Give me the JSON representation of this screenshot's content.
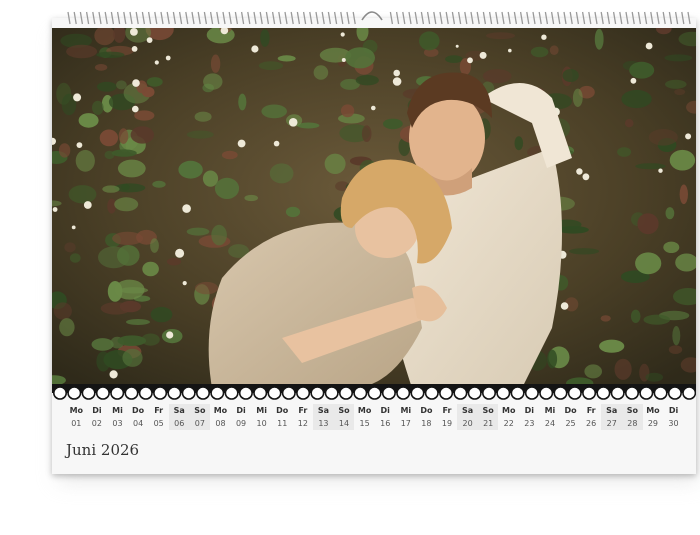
{
  "calendar": {
    "month_label": "Juni 2026",
    "days": [
      {
        "dn": "Mo",
        "dd": "01",
        "we": false
      },
      {
        "dn": "Di",
        "dd": "02",
        "we": false
      },
      {
        "dn": "Mi",
        "dd": "03",
        "we": false
      },
      {
        "dn": "Do",
        "dd": "04",
        "we": false
      },
      {
        "dn": "Fr",
        "dd": "05",
        "we": false
      },
      {
        "dn": "Sa",
        "dd": "06",
        "we": true
      },
      {
        "dn": "So",
        "dd": "07",
        "we": true
      },
      {
        "dn": "Mo",
        "dd": "08",
        "we": false
      },
      {
        "dn": "Di",
        "dd": "09",
        "we": false
      },
      {
        "dn": "Mi",
        "dd": "10",
        "we": false
      },
      {
        "dn": "Do",
        "dd": "11",
        "we": false
      },
      {
        "dn": "Fr",
        "dd": "12",
        "we": false
      },
      {
        "dn": "Sa",
        "dd": "13",
        "we": true
      },
      {
        "dn": "So",
        "dd": "14",
        "we": true
      },
      {
        "dn": "Mo",
        "dd": "15",
        "we": false
      },
      {
        "dn": "Di",
        "dd": "16",
        "we": false
      },
      {
        "dn": "Mi",
        "dd": "17",
        "we": false
      },
      {
        "dn": "Do",
        "dd": "18",
        "we": false
      },
      {
        "dn": "Fr",
        "dd": "19",
        "we": false
      },
      {
        "dn": "Sa",
        "dd": "20",
        "we": true
      },
      {
        "dn": "So",
        "dd": "21",
        "we": true
      },
      {
        "dn": "Mo",
        "dd": "22",
        "we": false
      },
      {
        "dn": "Di",
        "dd": "23",
        "we": false
      },
      {
        "dn": "Mi",
        "dd": "24",
        "we": false
      },
      {
        "dn": "Do",
        "dd": "25",
        "we": false
      },
      {
        "dn": "Fr",
        "dd": "26",
        "we": false
      },
      {
        "dn": "Sa",
        "dd": "27",
        "we": true
      },
      {
        "dn": "So",
        "dd": "28",
        "we": true
      },
      {
        "dn": "Mo",
        "dd": "29",
        "we": false
      },
      {
        "dn": "Di",
        "dd": "30",
        "we": false
      }
    ]
  }
}
